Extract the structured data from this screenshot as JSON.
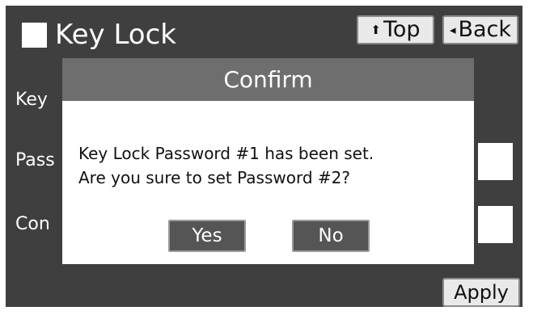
{
  "header": {
    "title": "Key Lock",
    "top_button": {
      "glyph": "⬆",
      "label": "Top"
    },
    "back_button": {
      "glyph": "◂",
      "label": "Back"
    }
  },
  "form": {
    "rows": [
      {
        "label": "Key"
      },
      {
        "label": "Pass"
      },
      {
        "label": "Con"
      }
    ]
  },
  "footer": {
    "apply_label": "Apply"
  },
  "dialog": {
    "title": "Confirm",
    "message_lines": [
      "Key Lock Password #1 has been set.",
      "Are you sure to set Password #2?"
    ],
    "yes_label": "Yes",
    "no_label": "No"
  },
  "colors": {
    "background": "#3f3f3f",
    "dialog_header": "#6e6e6e",
    "dialog_button": "#555555"
  }
}
